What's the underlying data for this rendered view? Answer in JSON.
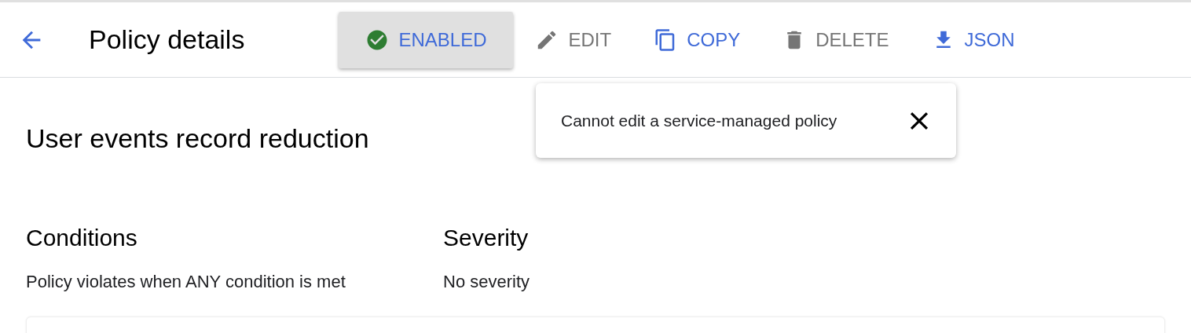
{
  "header": {
    "title": "Policy details"
  },
  "actions": [
    {
      "kind": "toggle",
      "label": "ENABLED",
      "active": true,
      "disabled": false
    },
    {
      "kind": "edit",
      "label": "EDIT",
      "active": false,
      "disabled": true
    },
    {
      "kind": "copy",
      "label": "COPY",
      "active": false,
      "disabled": false
    },
    {
      "kind": "delete",
      "label": "DELETE",
      "active": false,
      "disabled": true
    },
    {
      "kind": "download",
      "label": "JSON",
      "active": false,
      "disabled": false
    }
  ],
  "tooltip": {
    "text": "Cannot edit a service-managed policy"
  },
  "policy": {
    "name": "User events record reduction"
  },
  "sections": [
    {
      "heading": "Conditions",
      "value": "Policy violates when ANY condition is met"
    },
    {
      "heading": "Severity",
      "value": "No severity"
    }
  ]
}
